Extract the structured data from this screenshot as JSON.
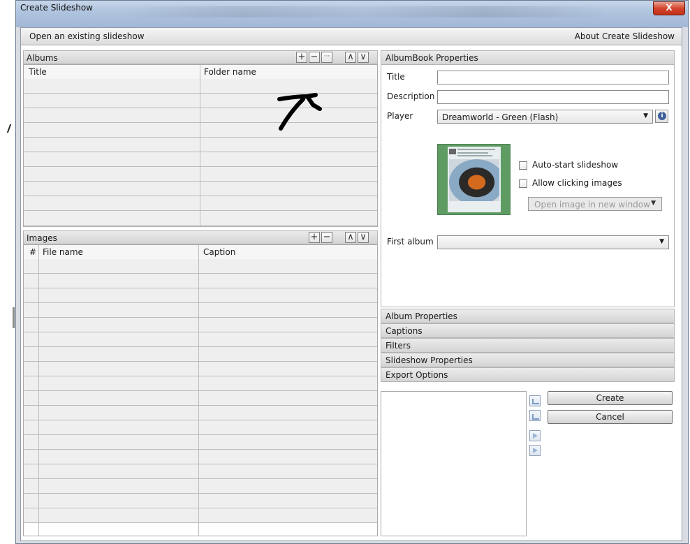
{
  "window": {
    "title": "Create Slideshow",
    "close_glyph": "X"
  },
  "topbar": {
    "open_label": "Open an existing slideshow",
    "about_label": "About Create Slideshow"
  },
  "albums": {
    "heading": "Albums",
    "columns": [
      "Title",
      "Folder name"
    ],
    "toolbar": {
      "add": "+",
      "remove": "−",
      "more": "···",
      "up": "∧",
      "down": "∨"
    },
    "row_count": 10
  },
  "images": {
    "heading": "Images",
    "columns": [
      "#",
      "File name",
      "Caption"
    ],
    "toolbar": {
      "add": "+",
      "remove": "−",
      "up": "∧",
      "down": "∨"
    },
    "row_count": 18
  },
  "albumbook": {
    "heading": "AlbumBook Properties",
    "title_label": "Title",
    "title_value": "",
    "description_label": "Description",
    "description_value": "",
    "player_label": "Player",
    "player_value": "Dreamworld - Green (Flash)",
    "info_glyph": "i",
    "autostart_label": "Auto-start slideshow",
    "autostart_checked": false,
    "allow_click_label": "Allow clicking images",
    "allow_click_checked": false,
    "open_mode_value": "Open image in new window",
    "first_album_label": "First album",
    "first_album_value": ""
  },
  "sections": [
    "Album Properties",
    "Captions",
    "Filters",
    "Slideshow Properties",
    "Export Options"
  ],
  "actions": {
    "create_label": "Create",
    "cancel_label": "Cancel"
  },
  "icons": [
    "scribble-arrow-icon",
    "collapse-icon",
    "expand-icon",
    "arrow-right-icon"
  ],
  "colors": {
    "thumb_green": "#5e9c64",
    "close_red": "#c3321a",
    "title_blue": "#aec3de"
  }
}
